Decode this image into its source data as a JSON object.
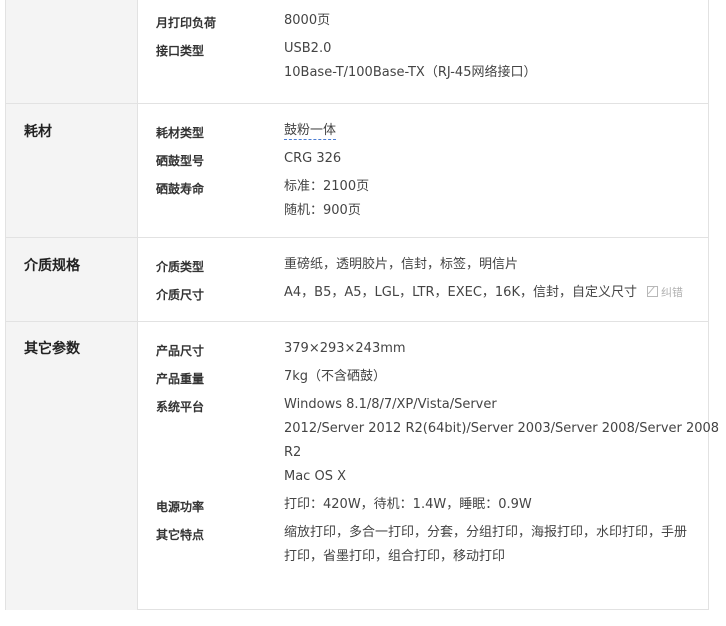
{
  "sections": {
    "print": {
      "rows": [
        {
          "key": "月打印负荷",
          "value": "8000页"
        },
        {
          "key": "接口类型",
          "lines": [
            "USB2.0",
            "10Base-T/100Base-TX（RJ-45网络接口）"
          ]
        }
      ]
    },
    "consumables": {
      "title": "耗材",
      "rows": [
        {
          "key": "耗材类型",
          "value": "鼓粉一体"
        },
        {
          "key": "硒鼓型号",
          "value": "CRG 326"
        },
        {
          "key": "硒鼓寿命",
          "lines": [
            "标准：2100页",
            "随机：900页"
          ]
        }
      ]
    },
    "media": {
      "title": "介质规格",
      "rows": [
        {
          "key": "介质类型",
          "value": "重磅纸，透明胶片，信封，标签，明信片"
        },
        {
          "key": "介质尺寸",
          "value": "A4，B5，A5，LGL，LTR，EXEC，16K，信封，自定义尺寸",
          "correction": "纠错"
        }
      ]
    },
    "other": {
      "title": "其它参数",
      "rows": [
        {
          "key": "产品尺寸",
          "value": "379×293×243mm"
        },
        {
          "key": "产品重量",
          "value": "7kg（不含硒鼓）"
        },
        {
          "key": "系统平台",
          "lines": [
            "Windows 8.1/8/7/XP/Vista/Server",
            "2012/Server 2012 R2(64bit)/Server 2003/Server 2008/Server 2008",
            "R2",
            "Mac OS X"
          ]
        },
        {
          "key": "电源功率",
          "value": "打印：420W，待机：1.4W，睡眠：0.9W"
        },
        {
          "key": "其它特点",
          "lines": [
            "缩放打印，多合一打印，分套，分组打印，海报打印，水印打印，手册",
            "打印，省墨打印，组合打印，移动打印"
          ]
        }
      ]
    }
  }
}
